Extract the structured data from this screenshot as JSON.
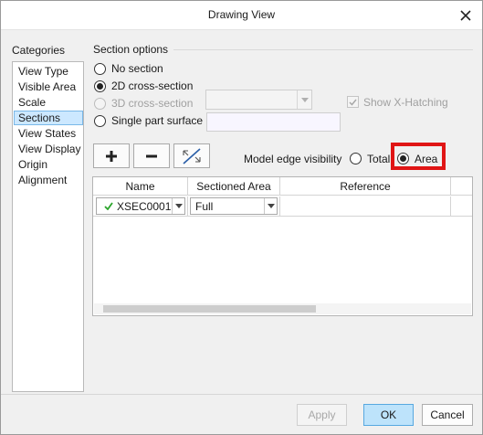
{
  "window": {
    "title": "Drawing View"
  },
  "categories": {
    "label": "Categories",
    "items": [
      "View Type",
      "Visible Area",
      "Scale",
      "Sections",
      "View States",
      "View Display",
      "Origin",
      "Alignment"
    ],
    "selected": "Sections"
  },
  "section_options": {
    "label": "Section options",
    "no_section": "No section",
    "cross_2d": "2D cross-section",
    "cross_3d": "3D cross-section",
    "single_part": "Single part surface",
    "show_hatching": "Show X-Hatching",
    "selected": "2D cross-section"
  },
  "visibility": {
    "label": "Model edge visibility",
    "total": "Total",
    "area": "Area",
    "selected": "Area"
  },
  "table": {
    "columns": [
      "Name",
      "Sectioned Area",
      "Reference"
    ],
    "rows": [
      {
        "name": "XSEC0001",
        "sectioned_area": "Full",
        "reference": ""
      }
    ]
  },
  "buttons": {
    "apply": "Apply",
    "ok": "OK",
    "cancel": "Cancel"
  },
  "colors": {
    "highlight": "#e01515",
    "check": "#2aa52a",
    "selection": "#cce8ff"
  }
}
